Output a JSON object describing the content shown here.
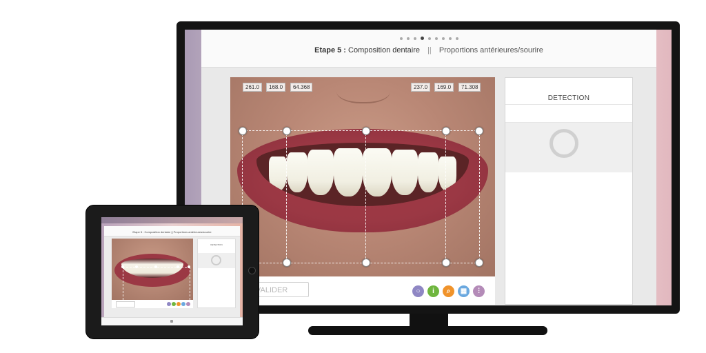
{
  "header": {
    "step_label": "Etape 5 :",
    "step_title": "Composition dentaire",
    "separator": "||",
    "step_subtitle": "Proportions antérieures/sourire",
    "progress_dots": 9,
    "active_dot": 3
  },
  "photo": {
    "measurements_left": [
      "261.0",
      "168.0",
      "64.368"
    ],
    "measurements_right": [
      "237.0",
      "169.0",
      "71.308"
    ]
  },
  "actions": {
    "valider_label": "VALIDER",
    "tools": [
      {
        "name": "chat-icon",
        "glyph": "○",
        "color": "#8f87c4"
      },
      {
        "name": "info-icon",
        "glyph": "i",
        "color": "#6fb63f"
      },
      {
        "name": "search-icon",
        "glyph": "⌕",
        "color": "#f0932b"
      },
      {
        "name": "grid-icon",
        "glyph": "▦",
        "color": "#6aa8df"
      },
      {
        "name": "sliders-icon",
        "glyph": "⫶",
        "color": "#b48bb8"
      }
    ]
  },
  "detection": {
    "title": "DETECTION"
  },
  "colors": {
    "accent_purple": "#8f87c4",
    "accent_green": "#6fb63f",
    "accent_orange": "#f0932b",
    "accent_blue": "#6aa8df",
    "accent_mauve": "#b48bb8"
  }
}
